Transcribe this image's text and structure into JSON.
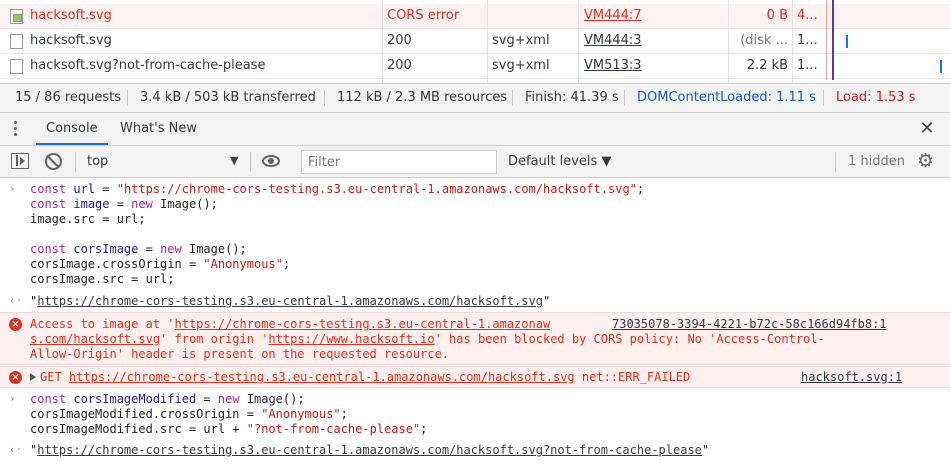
{
  "network": {
    "rows": [
      {
        "name": "hacksoft.svg",
        "status": "CORS error",
        "type": "",
        "initiator": "VM444:7",
        "size": "0 B",
        "time": "4..."
      },
      {
        "name": "hacksoft.svg",
        "status": "200",
        "type": "svg+xml",
        "initiator": "VM444:3",
        "size": "(disk ...",
        "time": "1..."
      },
      {
        "name": "hacksoft.svg?not-from-cache-please",
        "status": "200",
        "type": "svg+xml",
        "initiator": "VM513:3",
        "size": "2.2 kB",
        "time": "1..."
      }
    ],
    "summary": {
      "requests": "15 / 86 requests",
      "transferred": "3.4 kB / 503 kB transferred",
      "resources": "112 kB / 2.3 MB resources",
      "finish": "Finish: 41.39 s",
      "dom_content_loaded": "DOMContentLoaded: 1.11 s",
      "load": "Load: 1.53 s"
    }
  },
  "drawer": {
    "tabs": [
      "Console",
      "What's New"
    ],
    "active_tab": "Console",
    "close": "✕"
  },
  "toolbar": {
    "context": "top",
    "filter_placeholder": "Filter",
    "levels": "Default levels ▼",
    "hidden": "1 hidden"
  },
  "console": {
    "input1": {
      "l1": [
        "const ",
        "url",
        " = ",
        "\"https://chrome-cors-testing.s3.eu-central-1.amazonaws.com/hacksoft.svg\"",
        ";"
      ],
      "l2": [
        "const ",
        "image",
        " = ",
        "new ",
        "Image();"
      ],
      "l3": "image.src = url;",
      "l5": [
        "const ",
        "corsImage",
        " = ",
        "new ",
        "Image();"
      ],
      "l6": [
        "corsImage.crossOrigin = ",
        "\"Anonymous\"",
        ";"
      ],
      "l7": "corsImage.src = url;"
    },
    "result1": {
      "prefix": "\"",
      "link": "https://chrome-cors-testing.s3.eu-central-1.amazonaws.com/hacksoft.svg",
      "suffix": "\""
    },
    "error1": {
      "l1_a": "Access to image at '",
      "l1_link": "https://chrome-cors-testing.s3.eu-central-1.amazonaw",
      "source": "73035078-3394-4221-b72c-58c166d94fb8:1",
      "l2_link": "s.com/hacksoft.svg",
      "l2_b": "' from origin '",
      "l2_origin": "https://www.hacksoft.io",
      "l2_c": "' has been blocked by CORS policy: No 'Access-Control-",
      "l3": "Allow-Origin' header is present on the requested resource."
    },
    "error2": {
      "method": "GET",
      "url": "https://chrome-cors-testing.s3.eu-central-1.amazonaws.com/hacksoft.svg",
      "status": "net::ERR_FAILED",
      "source": "hacksoft.svg:1"
    },
    "input2": {
      "l1": [
        "const ",
        "corsImageModified",
        " = ",
        "new ",
        "Image();"
      ],
      "l2": [
        "corsImageModified.crossOrigin = ",
        "\"Anonymous\"",
        ";"
      ],
      "l3": [
        "corsImageModified.src = url + ",
        "\"?not-from-cache-please\"",
        ";"
      ]
    },
    "result2": {
      "prefix": "\"",
      "link": "https://chrome-cors-testing.s3.eu-central-1.amazonaws.com/hacksoft.svg?not-from-cache-please",
      "suffix": "\""
    },
    "glyphs": {
      "input_prompt": "›",
      "result_arrow": "‹·",
      "error_icon": "×"
    }
  },
  "colors": {
    "error_red": "#e0301e",
    "keyword": "#a0289f",
    "string": "#c41a16",
    "link_blue": "#1a57c6",
    "tab_underline": "#1a73e8"
  }
}
